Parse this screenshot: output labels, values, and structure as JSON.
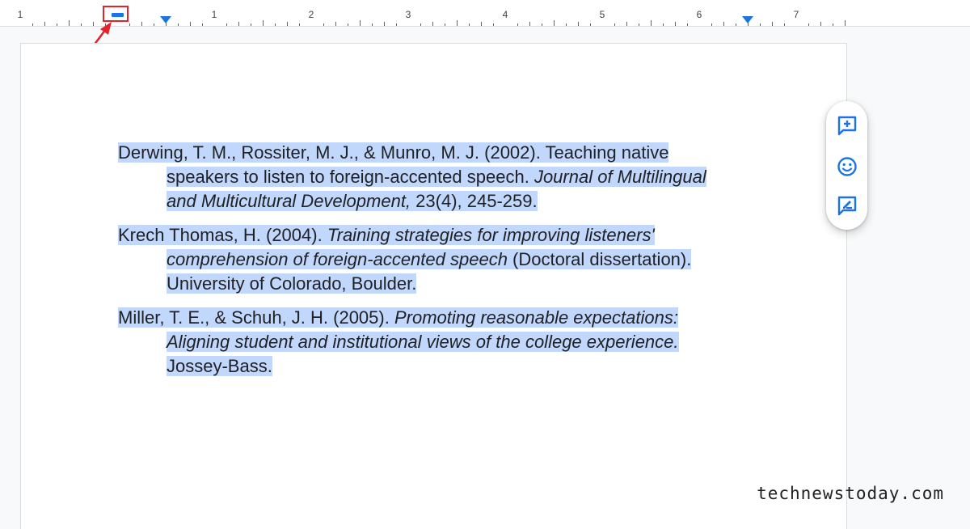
{
  "ruler": {
    "numbers": [
      "1",
      "1",
      "2",
      "3",
      "4",
      "5",
      "6",
      "7"
    ]
  },
  "references": [
    {
      "lines": [
        [
          {
            "text": "Derwing, T. M., Rossiter, M. J., & Munro, M. J. (2002). Teaching native",
            "italic": false
          }
        ],
        [
          {
            "text": "speakers to listen to foreign-accented speech. ",
            "italic": false
          },
          {
            "text": "Journal of Multilingual",
            "italic": true
          }
        ],
        [
          {
            "text": "and Multicultural Development,",
            "italic": true
          },
          {
            "text": " 23(4), 245-259.",
            "italic": false
          }
        ]
      ]
    },
    {
      "lines": [
        [
          {
            "text": "Krech Thomas, H. (2004). ",
            "italic": false
          },
          {
            "text": "Training strategies for improving listeners'",
            "italic": true
          }
        ],
        [
          {
            "text": "comprehension of foreign-accented speech",
            "italic": true
          },
          {
            "text": " (Doctoral dissertation).",
            "italic": false
          }
        ],
        [
          {
            "text": "University of Colorado, Boulder.",
            "italic": false
          }
        ]
      ]
    },
    {
      "lines": [
        [
          {
            "text": "Miller, T. E., & Schuh, J. H. (2005). ",
            "italic": false
          },
          {
            "text": "Promoting reasonable expectations:",
            "italic": true
          }
        ],
        [
          {
            "text": "Aligning student and institutional views of the college experience.",
            "italic": true
          }
        ],
        [
          {
            "text": "Jossey-Bass.",
            "italic": false
          }
        ]
      ]
    }
  ],
  "toolbar": {
    "buttons": [
      {
        "name": "add-comment-icon"
      },
      {
        "name": "emoji-reaction-icon"
      },
      {
        "name": "suggest-edits-icon"
      }
    ]
  },
  "colors": {
    "selection": "#c2d7fc",
    "accent": "#1a73e8",
    "annotation": "#e3222b"
  },
  "watermark": "technewstoday.com"
}
